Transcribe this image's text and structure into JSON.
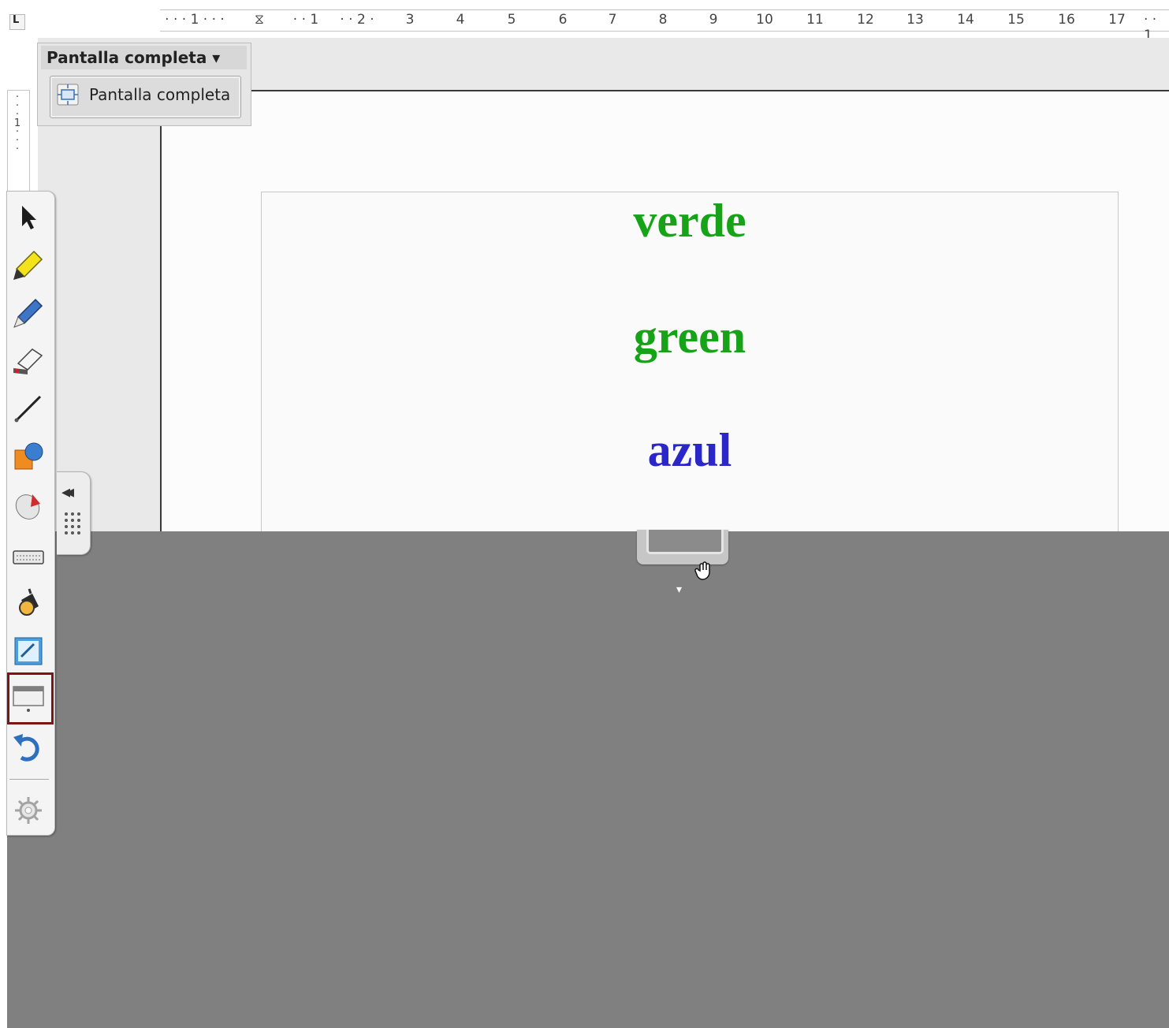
{
  "ruler": {
    "corner": "L",
    "ticks": [
      "· · · 1 · · ·",
      "⧖",
      "· · 1",
      "· · 2 ·",
      "3",
      "4",
      "5",
      "6",
      "7",
      "8",
      "9",
      "10",
      "11",
      "12",
      "13",
      "14",
      "15",
      "16",
      "17",
      "· · 1"
    ],
    "vertical_mark": "1"
  },
  "popup": {
    "title": "Pantalla completa ▾",
    "button_label": "Pantalla completa",
    "button_icon": "fullscreen-icon"
  },
  "document": {
    "words": [
      {
        "text": "verde",
        "color": "#17a317"
      },
      {
        "text": "green",
        "color": "#17a317"
      },
      {
        "text": "azul",
        "color": "#2a26c9"
      }
    ]
  },
  "palette": {
    "tools": [
      {
        "name": "select-arrow-icon"
      },
      {
        "name": "highlighter-icon"
      },
      {
        "name": "pen-icon"
      },
      {
        "name": "eraser-icon"
      },
      {
        "name": "line-icon"
      },
      {
        "name": "shapes-icon"
      },
      {
        "name": "mouse-icon"
      },
      {
        "name": "keyboard-icon"
      },
      {
        "name": "spotlight-icon"
      },
      {
        "name": "annotate-icon"
      },
      {
        "name": "screen-shade-icon"
      },
      {
        "name": "undo-icon"
      },
      {
        "name": "settings-icon"
      }
    ],
    "selected": "screen-shade-icon",
    "collapse": "◂◂"
  },
  "colors": {
    "stage": "#808080",
    "selection_border": "#7a1616",
    "green_text": "#17a317",
    "blue_text": "#2a26c9"
  }
}
